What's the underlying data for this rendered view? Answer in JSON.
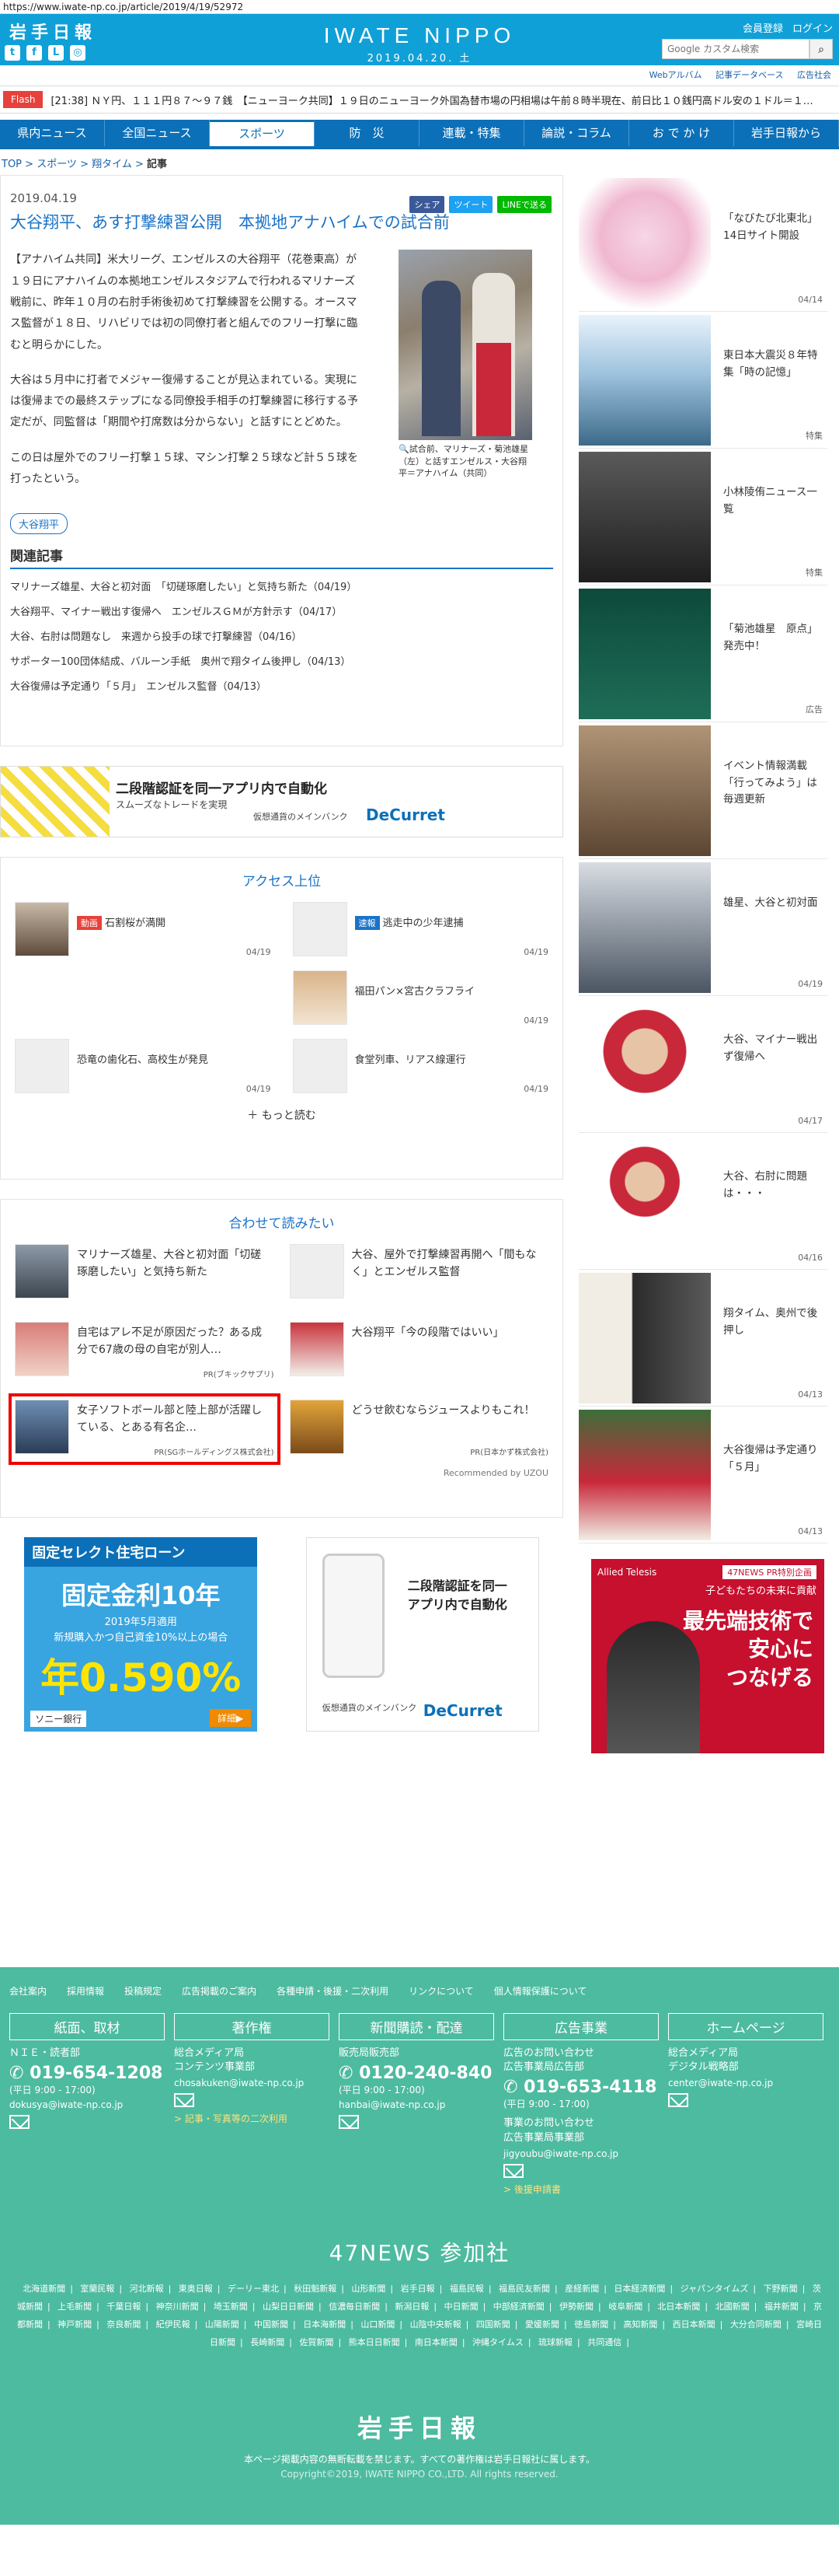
{
  "browser": {
    "url": "https://www.iwate-np.co.jp/article/2019/4/19/52972"
  },
  "header": {
    "logo": "岩手日報",
    "brand": "IWATE NIPPO",
    "date": "2019.04.20. 土",
    "links": [
      "会員登録",
      "ログイン"
    ],
    "search_placeholder": "Google カスタム検索",
    "social_icons": [
      "twitter-icon",
      "facebook-icon",
      "line-icon",
      "instagram-icon"
    ]
  },
  "subnav": [
    "Webアルバム",
    "記事データベース",
    "広告社会"
  ],
  "flash": {
    "label": "Flash",
    "text": "[21:38] ＮＹ円、１１１円８７～９７銭　【ニューヨーク共同】１９日のニューヨーク外国為替市場の円相場は午前８時半現在、前日比１０銭円高ドル安の１ドル＝１…"
  },
  "gnav": [
    "県内ニュース",
    "全国ニュース",
    "スポーツ",
    "防　災",
    "連載・特集",
    "論説・コラム",
    "お で か け",
    "岩手日報から"
  ],
  "breadcrumb": [
    "TOP",
    "スポーツ",
    "翔タイム",
    "記事"
  ],
  "article": {
    "date": "2019.04.19",
    "share": [
      "シェア",
      "ツイート",
      "LINEで送る"
    ],
    "title": "大谷翔平、あす打撃練習公開　本拠地アナハイムでの試合前",
    "paragraphs": [
      "【アナハイム共同】米大リーグ、エンゼルスの大谷翔平（花巻東高）が１９日にアナハイムの本拠地エンゼルスタジアムで行われるマリナーズ戦前に、昨年１０月の右肘手術後初めて打撃練習を公開する。オースマス監督が１８日、リハビリでは初の同僚打者と組んでのフリー打撃に臨むと明らかにした。",
      "大谷は５月中に打者でメジャー復帰することが見込まれている。実現には復帰までの最終ステップになる同僚投手相手の打撃練習に移行する予定だが、同監督は「期間や打席数は分からない」と話すにとどめた。",
      "この日は屋外でのフリー打撃１５球、マシン打撃２５球など計５５球を打ったという。"
    ],
    "photo_caption": "試合前、マリナーズ・菊池雄星（左）と話すエンゼルス・大谷翔平＝アナハイム（共同）",
    "tag": "大谷翔平",
    "related_heading": "関連記事",
    "related": [
      "マリナーズ雄星、大谷と初対面　「切磋琢磨したい」と気持ち新た（04/19）",
      "大谷翔平、マイナー戦出す復帰へ　エンゼルスＧＭが方針示す（04/17）",
      "大谷、右肘は問題なし　来週から投手の球で打撃練習（04/16）",
      "サポーター100団体結成、バルーン手紙　奥州で翔タイム後押し（04/13）",
      "大谷復帰は予定通り「５月」　エンゼルス監督（04/13）"
    ]
  },
  "ad_wide": {
    "line1": "二段階認証を同一アプリ内で自動化",
    "line2": "スムーズなトレードを実現",
    "line3": "仮想通貨のメインバンク",
    "brand": "DeCurret"
  },
  "ranking": {
    "title": "アクセス上位",
    "items": [
      {
        "badge": "動画",
        "badge_color": "#e8413b",
        "title": "石割桜が満開",
        "date": "04/19"
      },
      {
        "badge": "速報",
        "badge_color": "#1a73c8",
        "title": "逃走中の少年逮捕",
        "date": "04/19"
      },
      {
        "badge": "",
        "badge_color": "",
        "title": "",
        "date": ""
      },
      {
        "badge": "",
        "badge_color": "",
        "title": "福田パン×宮古クラフライ",
        "date": "04/19"
      },
      {
        "badge": "",
        "badge_color": "",
        "title": "恐竜の歯化石、高校生が発見",
        "date": "04/19"
      },
      {
        "badge": "",
        "badge_color": "",
        "title": "食堂列車、リアス線運行",
        "date": "04/19"
      }
    ],
    "more": "もっと読む"
  },
  "recommend": {
    "title": "合わせて読みたい",
    "items": [
      {
        "title": "マリナーズ雄星、大谷と初対面「切磋琢磨したい」と気持ち新た",
        "sponsor": ""
      },
      {
        "title": "大谷、屋外で打撃練習再開へ「間もなく」とエンゼルス監督",
        "sponsor": ""
      },
      {
        "title": "自宅はアレ不足が原因だった？ある成分で67歳の母の自宅が別人…",
        "sponsor": "PR(ブキックサプリ)"
      },
      {
        "title": "大谷翔平「今の段階ではいい」",
        "sponsor": ""
      },
      {
        "title": "女子ソフトボール部と陸上部が活躍している、とある有名企…",
        "sponsor": "PR(SGホールディングス株式会社)"
      },
      {
        "title": "どうせ飲むならジュースよりもこれ！",
        "sponsor": "PR(日本かず株式会社)"
      }
    ],
    "footer": "Recommended by UZOU"
  },
  "ad_loan": {
    "l1": "固定セレクト住宅ローン",
    "l2": "固定金利10年",
    "l3": "2019年5月適用\n新規購入かつ自己資金10%以上の場合",
    "l4": "年0.590%",
    "bank": "ソニー銀行",
    "cta": "詳細▶"
  },
  "ad_box": {
    "line1": "二段階認証を同一\nアプリ内で自動化",
    "line2": "仮想通貨のメインバンク",
    "brand": "DeCurret"
  },
  "sidebar": [
    {
      "title": "「なびたび北東北」14日サイト開設",
      "date": "04/14"
    },
    {
      "title": "東日本大震災８年特集「時の記憶」",
      "date": "特集"
    },
    {
      "title": "小林陵侑ニュース一覧",
      "date": "特集"
    },
    {
      "title": "「菊池雄星　原点」発売中！",
      "date": "広告"
    },
    {
      "title": "イベント情報満載「行ってみよう」は毎週更新",
      "date": ""
    },
    {
      "title": "雄星、大谷と初対面",
      "date": "04/19"
    },
    {
      "title": "大谷、マイナー戦出ず復帰へ",
      "date": "04/17"
    },
    {
      "title": "大谷、右肘に問題は・・・",
      "date": "04/16"
    },
    {
      "title": "翔タイム、奥州で後押し",
      "date": "04/13"
    },
    {
      "title": "大谷復帰は予定通り「５月」",
      "date": "04/13"
    }
  ],
  "side_ad": {
    "badge": "47NEWS PR特別企画",
    "sub": "子どもたちの未来に貢献",
    "main": "最先端技術で\n安心に\nつなげる",
    "brand": "Allied Telesis"
  },
  "footer": {
    "links": [
      "会社案内",
      "採用情報",
      "投稿規定",
      "広告掲載のご案内",
      "各種申請・後援・二次利用",
      "リンクについて",
      "個人情報保護について"
    ],
    "cols": [
      {
        "head": "紙面、取材",
        "label": "ＮＩＥ・読者部",
        "tel": "019-654-1208",
        "hours": "(平日 9:00 - 17:00)",
        "mail": "dokusya@iwate-np.co.jp",
        "link": ""
      },
      {
        "head": "著作権",
        "label": "総合メディア局\nコンテンツ事業部",
        "tel": "",
        "hours": "",
        "mail": "chosakuken@iwate-np.co.jp",
        "link": "> 記事・写真等の二次利用"
      },
      {
        "head": "新聞購読・配達",
        "label": "販売局販売部",
        "tel": "0120-240-840",
        "hours": "(平日 9:00 - 17:00)",
        "mail": "hanbai@iwate-np.co.jp",
        "link": ""
      },
      {
        "head": "広告事業",
        "label": "広告のお問い合わせ\n広告事業局広告部",
        "tel": "019-653-4118",
        "hours": "(平日 9:00 - 17:00)",
        "mail": "jigyoubu@iwate-np.co.jp",
        "link": "> 後援申請書"
      },
      {
        "head": "ホームページ",
        "label": "総合メディア局\nデジタル戦略部",
        "tel": "",
        "hours": "",
        "mail": "center@iwate-np.co.jp",
        "link": ""
      }
    ],
    "col4_extra": "事業のお問い合わせ\n広告事業局事業部",
    "n47_title": "47NEWS 参加社",
    "n47": [
      "北海道新聞",
      "室蘭民報",
      "河北新報",
      "東奥日報",
      "デーリー東北",
      "秋田魁新報",
      "山形新聞",
      "岩手日報",
      "福島民報",
      "福島民友新聞",
      "産経新聞",
      "日本経済新聞",
      "ジャパンタイムズ",
      "下野新聞",
      "茨城新聞",
      "上毛新聞",
      "千葉日報",
      "神奈川新聞",
      "埼玉新聞",
      "山梨日日新聞",
      "信濃毎日新聞",
      "新潟日報",
      "中日新聞",
      "中部経済新聞",
      "伊勢新聞",
      "岐阜新聞",
      "北日本新聞",
      "北國新聞",
      "福井新聞",
      "京都新聞",
      "神戸新聞",
      "奈良新聞",
      "紀伊民報",
      "山陽新聞",
      "中国新聞",
      "日本海新聞",
      "山口新聞",
      "山陰中央新報",
      "四国新聞",
      "愛媛新聞",
      "徳島新聞",
      "高知新聞",
      "西日本新聞",
      "大分合同新聞",
      "宮崎日日新聞",
      "長崎新聞",
      "佐賀新聞",
      "熊本日日新聞",
      "南日本新聞",
      "沖縄タイムス",
      "琉球新報",
      "共同通信"
    ],
    "logo": "岩手日報",
    "note": "本ページ掲載内容の無断転載を禁じます。すべての著作権は岩手日報社に属します。",
    "copyright": "Copyright©2019, IWATE NIPPO CO.,LTD. All rights reserved."
  }
}
